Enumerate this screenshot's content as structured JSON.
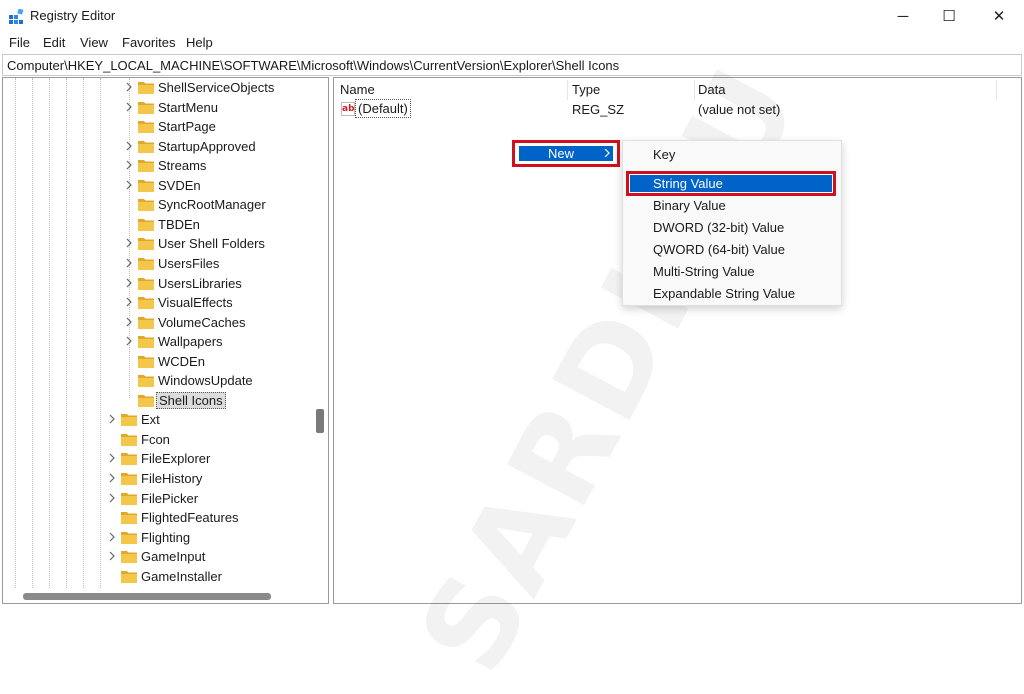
{
  "window": {
    "title": "Registry Editor",
    "controls": {
      "minimize": "─",
      "maximize": "☐",
      "close": "✕"
    }
  },
  "menubar": [
    "File",
    "Edit",
    "View",
    "Favorites",
    "Help"
  ],
  "address": "Computer\\HKEY_LOCAL_MACHINE\\SOFTWARE\\Microsoft\\Windows\\CurrentVersion\\Explorer\\Shell Icons",
  "tree": {
    "items": [
      {
        "label": "ShellServiceObjects",
        "expandable": true
      },
      {
        "label": "StartMenu",
        "expandable": true
      },
      {
        "label": "StartPage",
        "expandable": false
      },
      {
        "label": "StartupApproved",
        "expandable": true
      },
      {
        "label": "Streams",
        "expandable": true
      },
      {
        "label": "SVDEn",
        "expandable": true
      },
      {
        "label": "SyncRootManager",
        "expandable": false
      },
      {
        "label": "TBDEn",
        "expandable": false
      },
      {
        "label": "User Shell Folders",
        "expandable": true
      },
      {
        "label": "UsersFiles",
        "expandable": true
      },
      {
        "label": "UsersLibraries",
        "expandable": true
      },
      {
        "label": "VisualEffects",
        "expandable": true
      },
      {
        "label": "VolumeCaches",
        "expandable": true
      },
      {
        "label": "Wallpapers",
        "expandable": true
      },
      {
        "label": "WCDEn",
        "expandable": false
      },
      {
        "label": "WindowsUpdate",
        "expandable": false
      },
      {
        "label": "Shell Icons",
        "expandable": false,
        "selected": true
      },
      {
        "label": "Ext",
        "expandable": true
      },
      {
        "label": "Fcon",
        "expandable": false
      },
      {
        "label": "FileExplorer",
        "expandable": true
      },
      {
        "label": "FileHistory",
        "expandable": true
      },
      {
        "label": "FilePicker",
        "expandable": true
      },
      {
        "label": "FlightedFeatures",
        "expandable": false
      },
      {
        "label": "Flighting",
        "expandable": true
      },
      {
        "label": "GameInput",
        "expandable": true
      },
      {
        "label": "GameInstaller",
        "expandable": false
      }
    ]
  },
  "values": {
    "columns": {
      "name": "Name",
      "type": "Type",
      "data": "Data"
    },
    "rows": [
      {
        "name": "(Default)",
        "type": "REG_SZ",
        "data": "(value not set)",
        "icon": "string-value-icon"
      }
    ]
  },
  "context_menu": {
    "new_label": "New",
    "submenu": [
      "Key",
      "String Value",
      "Binary Value",
      "DWORD (32-bit) Value",
      "QWORD (64-bit) Value",
      "Multi-String Value",
      "Expandable String Value"
    ],
    "highlighted": "String Value"
  },
  "watermark": "SARDIMU",
  "colors": {
    "highlight": "#0063c8",
    "annotation_box": "#d0101e",
    "folder": "#f4c74a"
  }
}
